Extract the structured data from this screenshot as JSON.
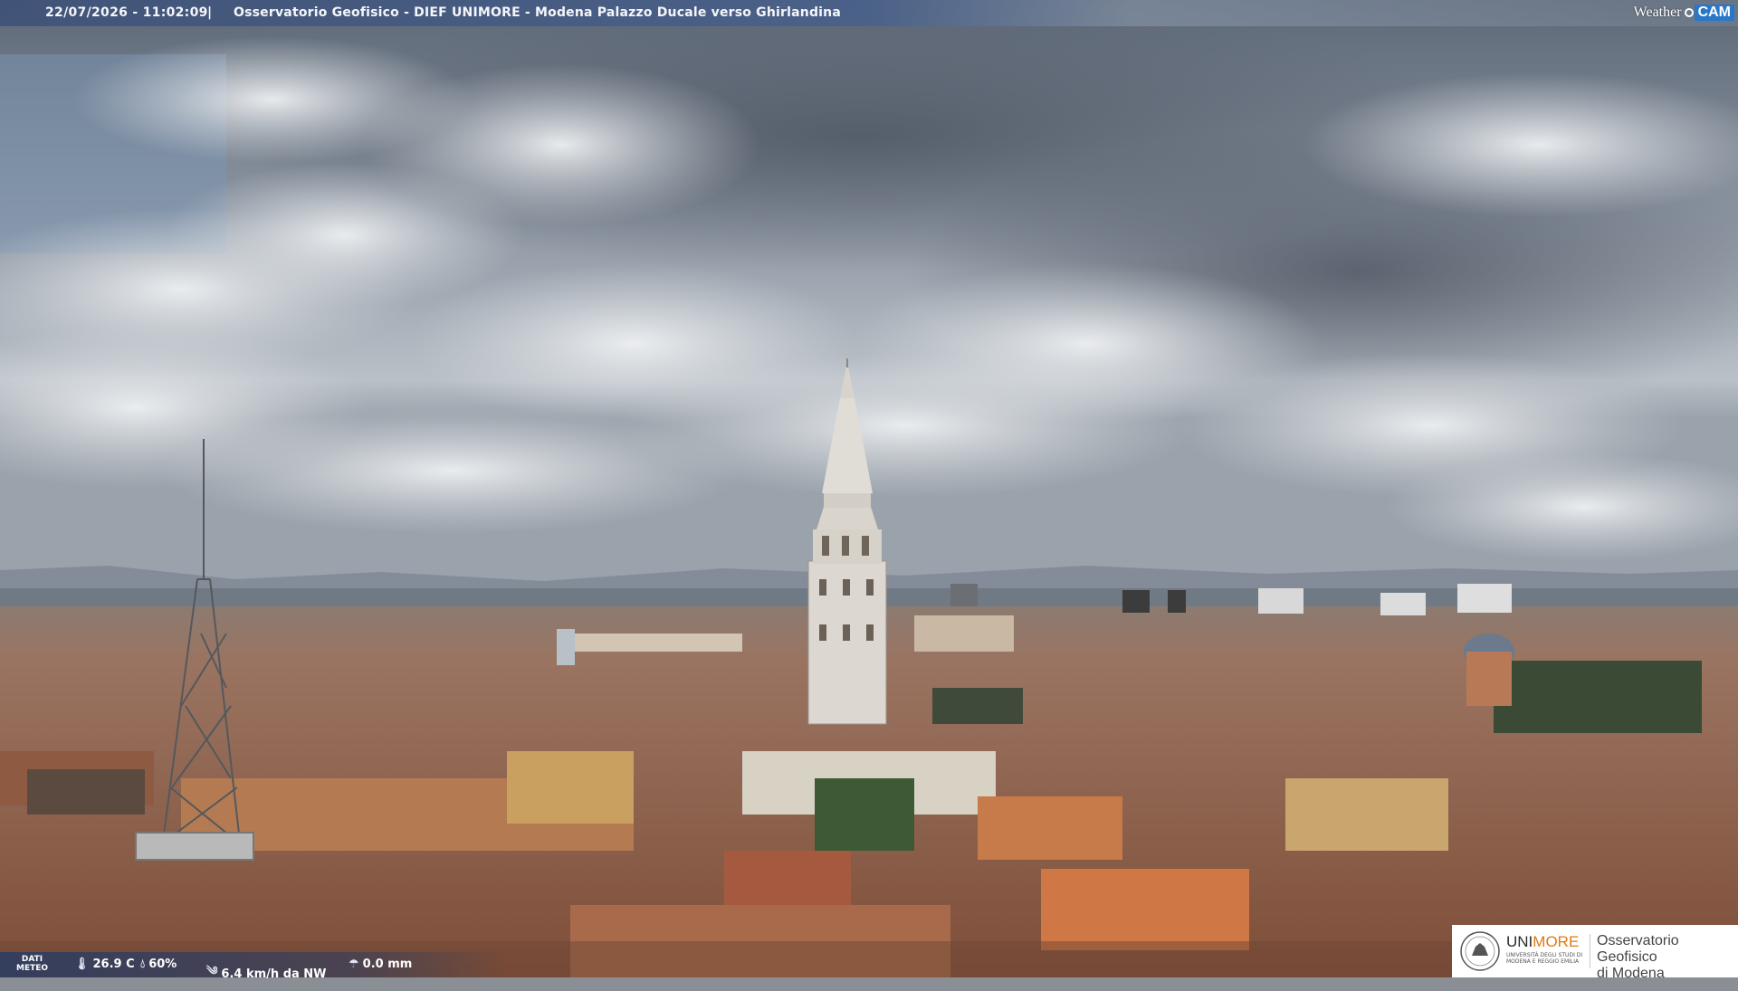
{
  "header": {
    "timestamp": "22/07/2026 - 11:02:09",
    "separator": "|",
    "location": "Osservatorio Geofisico - DIEF UNIMORE - Modena Palazzo Ducale verso Ghirlandina"
  },
  "brand": {
    "weather": "Weather",
    "cam": "CAM"
  },
  "weather_bar": {
    "label_line1": "DATI",
    "label_line2": "METEO",
    "temperature": "26.9 C",
    "humidity": "60%",
    "wind": "6.4 km/h da NW",
    "rain": "0.0 mm",
    "icons": [
      "thermometer-icon",
      "humidity-drop-icon",
      "wind-icon",
      "rain-icon"
    ]
  },
  "footer_logo": {
    "uni_part1": "UNI",
    "uni_part2": "MORE",
    "uni_sub": "UNIVERSITÀ DEGLI STUDI DI MODENA E REGGIO EMILIA",
    "obs_line1": "Osservatorio Geofisico",
    "obs_line2": "di Modena",
    "accent": "#e07a14"
  },
  "colors": {
    "sky": "#9aa3ad",
    "roofs": "#a8694a",
    "tower": "#d9d6d0"
  }
}
